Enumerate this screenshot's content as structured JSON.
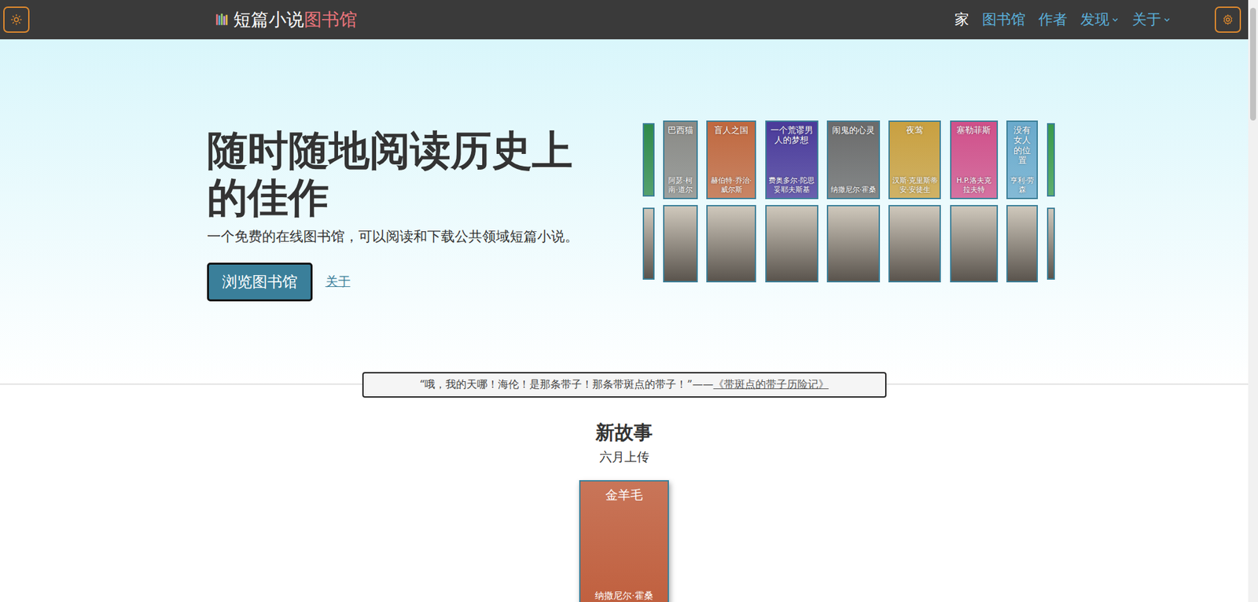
{
  "nav": {
    "logo_main": "短篇小说",
    "logo_accent": "图书馆",
    "links": [
      {
        "label": "家",
        "selected": true,
        "dropdown": false
      },
      {
        "label": "图书馆",
        "selected": false,
        "dropdown": false
      },
      {
        "label": "作者",
        "selected": false,
        "dropdown": false
      },
      {
        "label": "发现",
        "selected": false,
        "dropdown": true
      },
      {
        "label": "关于",
        "selected": false,
        "dropdown": true
      }
    ]
  },
  "hero": {
    "title": "随时随地阅读历史上的佳作",
    "subtitle": "一个免费的在线图书馆，可以阅读和下载公共领域短篇小说。",
    "primary_button": "浏览图书馆",
    "secondary_link": "关于"
  },
  "covers": [
    {
      "kind": "sliver",
      "color": "#2f8a4a"
    },
    {
      "kind": "cover",
      "title": "巴西猫",
      "author": "阿瑟·柯南·道尔",
      "color": "#8a8a86"
    },
    {
      "kind": "cover",
      "title": "盲人之国",
      "author": "赫伯特·乔治·威尔斯",
      "color": "#c0683f"
    },
    {
      "kind": "cover",
      "title": "一个荒谬男人的梦想",
      "author": "费奥多尔·陀思妥耶夫斯基",
      "color": "#4a3a9a"
    },
    {
      "kind": "cover",
      "title": "闹鬼的心灵",
      "author": "纳撒尼尔·霍桑",
      "color": "#6b6b6b"
    },
    {
      "kind": "cover",
      "title": "夜莺",
      "author": "汉斯·克里斯蒂安·安徒生",
      "color": "#c9a040"
    },
    {
      "kind": "cover",
      "title": "塞勒菲斯",
      "author": "H.P.洛夫克拉夫特",
      "color": "#d0508a"
    },
    {
      "kind": "cover",
      "title": "没有女人的位置",
      "author": "亨利·劳森",
      "color": "#6aaacc"
    },
    {
      "kind": "sliver",
      "color": "#3a9a4a"
    }
  ],
  "quote": {
    "text": "“哦，我的天哪！海伦！是那条带子！那条带斑点的带子！”——",
    "source": "《带斑点的带子历险记》"
  },
  "new_stories": {
    "heading": "新故事",
    "subheading": "六月上传",
    "stories": [
      {
        "title": "金羊毛",
        "author": "纳撒尼尔·霍桑",
        "color": "#c0603f"
      }
    ]
  }
}
